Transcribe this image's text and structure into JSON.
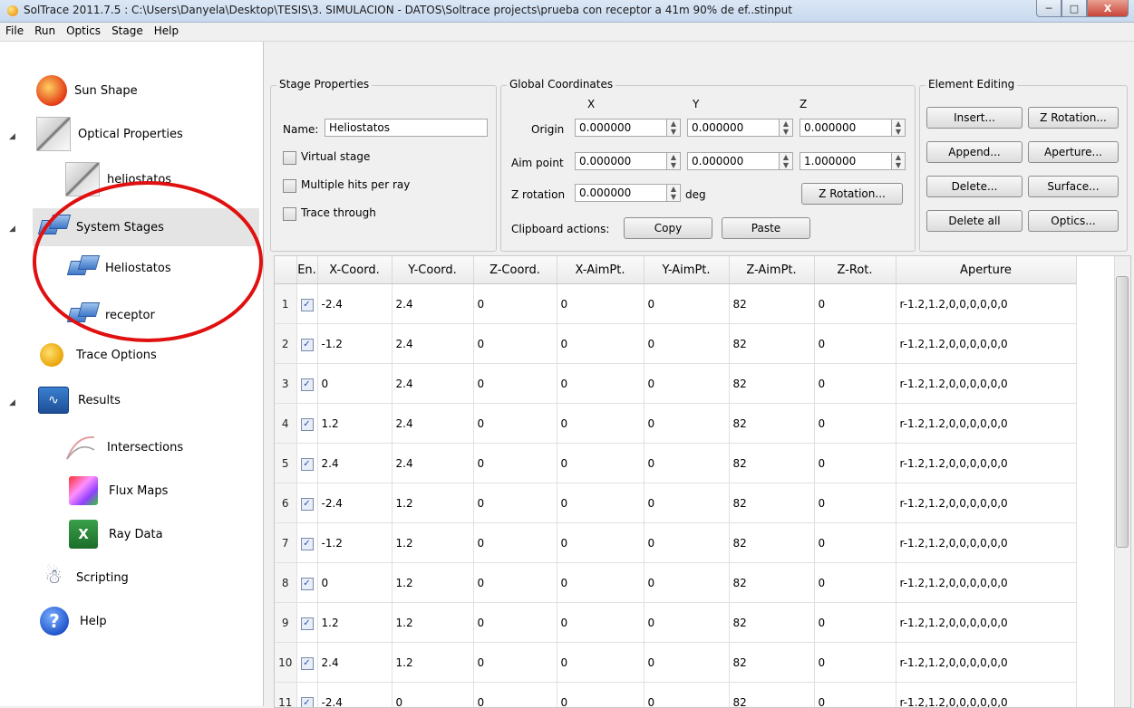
{
  "window": {
    "title": "SolTrace 2011.7.5 : C:\\Users\\Danyela\\Desktop\\TESIS\\3. SIMULACION - DATOS\\Soltrace projects\\prueba con receptor a 41m 90% de ef..stinput",
    "minimize": "─",
    "maximize": "□",
    "close": "X"
  },
  "menu": [
    "File",
    "Run",
    "Optics",
    "Stage",
    "Help"
  ],
  "sidebar": {
    "sun_shape": "Sun Shape",
    "optical_properties": "Optical Properties",
    "heliostatos_optic": "heliostatos",
    "system_stages": "System Stages",
    "stage_heliostatos": "Heliostatos",
    "stage_receptor": "receptor",
    "trace_options": "Trace Options",
    "results": "Results",
    "intersections": "Intersections",
    "flux_maps": "Flux Maps",
    "ray_data": "Ray Data",
    "scripting": "Scripting",
    "help": "Help",
    "excel_glyph": "X",
    "help_glyph": "?"
  },
  "stage_properties": {
    "title": "Stage Properties",
    "name_label": "Name:",
    "name_value": "Heliostatos",
    "virtual_stage": "Virtual stage",
    "multiple_hits": "Multiple hits per ray",
    "trace_through": "Trace through"
  },
  "global_coordinates": {
    "title": "Global Coordinates",
    "x_header": "X",
    "y_header": "Y",
    "z_header": "Z",
    "origin_label": "Origin",
    "origin": [
      "0.000000",
      "0.000000",
      "0.000000"
    ],
    "aim_label": "Aim point",
    "aim": [
      "0.000000",
      "0.000000",
      "1.000000"
    ],
    "zrot_label": "Z rotation",
    "zrot_value": "0.000000",
    "deg_label": "deg",
    "zrot_button": "Z Rotation...",
    "clipboard_label": "Clipboard actions:",
    "copy": "Copy",
    "paste": "Paste"
  },
  "element_editing": {
    "title": "Element Editing",
    "insert": "Insert...",
    "zrotation": "Z Rotation...",
    "append": "Append...",
    "aperture": "Aperture...",
    "delete": "Delete...",
    "surface": "Surface...",
    "delete_all": "Delete all",
    "optics": "Optics..."
  },
  "table": {
    "headers": [
      "",
      "En.",
      "X-Coord.",
      "Y-Coord.",
      "Z-Coord.",
      "X-AimPt.",
      "Y-AimPt.",
      "Z-AimPt.",
      "Z-Rot.",
      "Aperture"
    ],
    "rows": [
      {
        "n": "1",
        "en": "✓",
        "x": "-2.4",
        "y": "2.4",
        "z": "0",
        "xa": "0",
        "ya": "0",
        "za": "82",
        "zr": "0",
        "ap": "r-1.2,1.2,0,0,0,0,0,0"
      },
      {
        "n": "2",
        "en": "✓",
        "x": "-1.2",
        "y": "2.4",
        "z": "0",
        "xa": "0",
        "ya": "0",
        "za": "82",
        "zr": "0",
        "ap": "r-1.2,1.2,0,0,0,0,0,0"
      },
      {
        "n": "3",
        "en": "✓",
        "x": "0",
        "y": "2.4",
        "z": "0",
        "xa": "0",
        "ya": "0",
        "za": "82",
        "zr": "0",
        "ap": "r-1.2,1.2,0,0,0,0,0,0"
      },
      {
        "n": "4",
        "en": "✓",
        "x": "1.2",
        "y": "2.4",
        "z": "0",
        "xa": "0",
        "ya": "0",
        "za": "82",
        "zr": "0",
        "ap": "r-1.2,1.2,0,0,0,0,0,0"
      },
      {
        "n": "5",
        "en": "✓",
        "x": "2.4",
        "y": "2.4",
        "z": "0",
        "xa": "0",
        "ya": "0",
        "za": "82",
        "zr": "0",
        "ap": "r-1.2,1.2,0,0,0,0,0,0"
      },
      {
        "n": "6",
        "en": "✓",
        "x": "-2.4",
        "y": "1.2",
        "z": "0",
        "xa": "0",
        "ya": "0",
        "za": "82",
        "zr": "0",
        "ap": "r-1.2,1.2,0,0,0,0,0,0"
      },
      {
        "n": "7",
        "en": "✓",
        "x": "-1.2",
        "y": "1.2",
        "z": "0",
        "xa": "0",
        "ya": "0",
        "za": "82",
        "zr": "0",
        "ap": "r-1.2,1.2,0,0,0,0,0,0"
      },
      {
        "n": "8",
        "en": "✓",
        "x": "0",
        "y": "1.2",
        "z": "0",
        "xa": "0",
        "ya": "0",
        "za": "82",
        "zr": "0",
        "ap": "r-1.2,1.2,0,0,0,0,0,0"
      },
      {
        "n": "9",
        "en": "✓",
        "x": "1.2",
        "y": "1.2",
        "z": "0",
        "xa": "0",
        "ya": "0",
        "za": "82",
        "zr": "0",
        "ap": "r-1.2,1.2,0,0,0,0,0,0"
      },
      {
        "n": "10",
        "en": "✓",
        "x": "2.4",
        "y": "1.2",
        "z": "0",
        "xa": "0",
        "ya": "0",
        "za": "82",
        "zr": "0",
        "ap": "r-1.2,1.2,0,0,0,0,0,0"
      },
      {
        "n": "11",
        "en": "✓",
        "x": "-2.4",
        "y": "0",
        "z": "0",
        "xa": "0",
        "ya": "0",
        "za": "82",
        "zr": "0",
        "ap": "r-1.2,1.2,0,0,0,0,0,0"
      }
    ]
  },
  "icons": {
    "expand": "◢",
    "spin_up": "▲",
    "spin_down": "▼"
  }
}
